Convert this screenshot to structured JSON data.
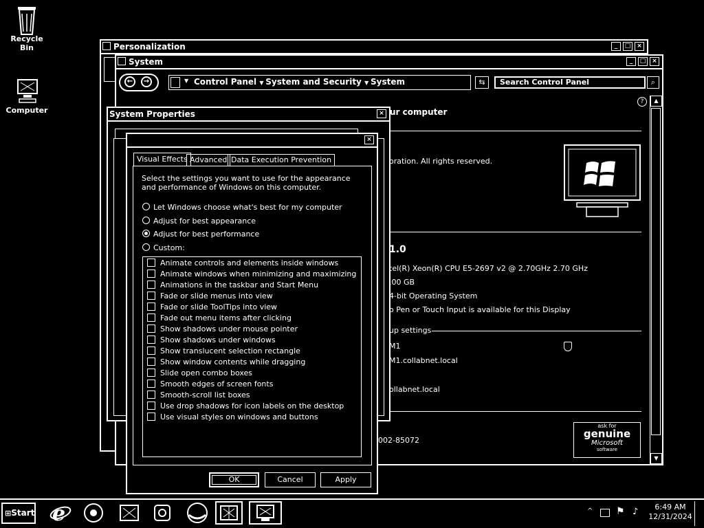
{
  "desktop": {
    "icons": [
      {
        "label": "Recycle Bin"
      },
      {
        "label": "Computer"
      }
    ]
  },
  "personalization": {
    "title": "Personalization"
  },
  "system_window": {
    "title": "System",
    "breadcrumb": [
      "Control Panel",
      "System and Security",
      "System"
    ],
    "search_placeholder": "Search Control Panel",
    "heading_fragment": "ur computer",
    "copyright_fragment": "oration.  All rights reserved.",
    "edition_fragment": "1.0",
    "processor_fragment": "tel(R) Xeon(R) CPU E5-2697 v2 @ 2.70GHz   2.70 GHz",
    "memory_fragment": ".00 GB",
    "systype_fragment": "4-bit Operating System",
    "pen_fragment": "o Pen or Touch Input is available for this Display",
    "workgroup_fragment": "up settings",
    "computer_name_fragment": "M1",
    "full_name_fragment": "M1.collabnet.local",
    "domain_fragment": "ollabnet.local",
    "product_id_fragment": "002-85072",
    "genuine": {
      "line1": "ask for",
      "line2": "genuine",
      "line3": "Microsoft",
      "line4": "software"
    }
  },
  "system_properties": {
    "title": "System Properties",
    "close": "×"
  },
  "perf_dialog": {
    "close": "×",
    "tabs": [
      "Visual Effects",
      "Advanced",
      "Data Execution Prevention"
    ],
    "description": "Select the settings you want to use for the appearance and performance of Windows on this computer.",
    "radios": [
      {
        "label": "Let Windows choose what's best for my computer",
        "selected": false
      },
      {
        "label": "Adjust for best appearance",
        "selected": false
      },
      {
        "label": "Adjust for best performance",
        "selected": true
      },
      {
        "label": "Custom:",
        "selected": false
      }
    ],
    "checkboxes": [
      "Animate controls and elements inside windows",
      "Animate windows when minimizing and maximizing",
      "Animations in the taskbar and Start Menu",
      "Fade or slide menus into view",
      "Fade or slide ToolTips into view",
      "Fade out menu items after clicking",
      "Show shadows under mouse pointer",
      "Show shadows under windows",
      "Show translucent selection rectangle",
      "Show window contents while dragging",
      "Slide open combo boxes",
      "Smooth edges of screen fonts",
      "Smooth-scroll list boxes",
      "Use drop shadows for icon labels on the desktop",
      "Use visual styles on windows and buttons"
    ],
    "buttons": {
      "ok": "OK",
      "cancel": "Cancel",
      "apply": "Apply"
    }
  },
  "taskbar": {
    "start_label": "Start",
    "time": "6:49 AM",
    "date": "12/31/2024"
  }
}
